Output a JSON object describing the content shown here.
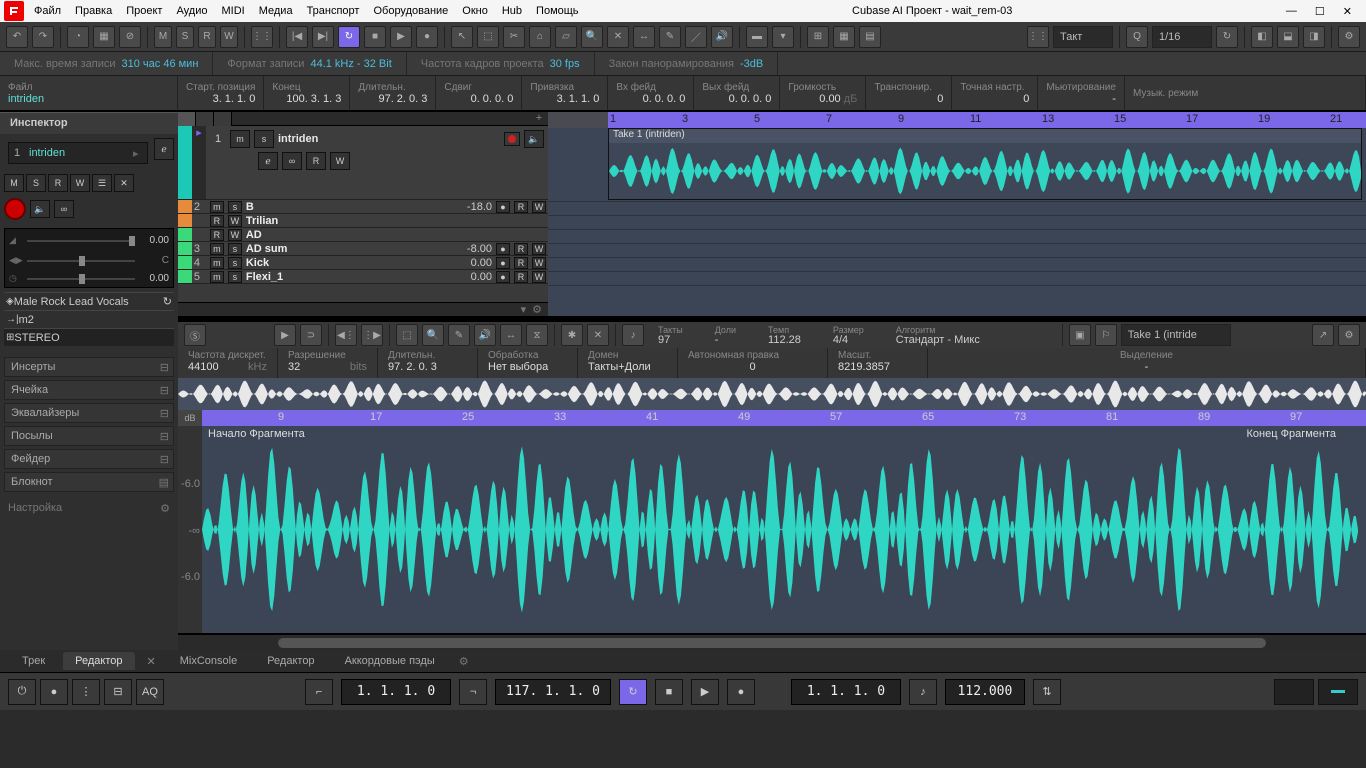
{
  "app_title": "Cubase AI Проект - wait_rem-03",
  "menu": [
    "Файл",
    "Правка",
    "Проект",
    "Аудио",
    "MIDI",
    "Медиа",
    "Транспорт",
    "Оборудование",
    "Окно",
    "Hub",
    "Помощь"
  ],
  "status": {
    "rec_time_lbl": "Макс. время записи",
    "rec_time": "310 час 46 мин",
    "fmt_lbl": "Формат записи",
    "fmt": "44.1 kHz - 32 Bit",
    "fps_lbl": "Частота кадров проекта",
    "fps": "30 fps",
    "pan_lbl": "Закон панорамирования",
    "pan": "-3dB"
  },
  "info_row": [
    {
      "lbl": "Файл",
      "val": "intriden",
      "left": true
    },
    {
      "lbl": "Старт. позиция",
      "val": "3. 1. 1.  0"
    },
    {
      "lbl": "Конец",
      "val": "100. 3. 1.  3"
    },
    {
      "lbl": "Длительн.",
      "val": "97. 2. 0.  3"
    },
    {
      "lbl": "Сдвиг",
      "val": "0. 0. 0.  0"
    },
    {
      "lbl": "Привязка",
      "val": "3. 1. 1.  0"
    },
    {
      "lbl": "Вх фейд",
      "val": "0. 0. 0.  0"
    },
    {
      "lbl": "Вых фейд",
      "val": "0. 0. 0.  0"
    },
    {
      "lbl": "Громкость",
      "val": "0.00",
      "unit": "дБ"
    },
    {
      "lbl": "Транспонир.",
      "val": "0"
    },
    {
      "lbl": "Точная настр.",
      "val": "0"
    },
    {
      "lbl": "Мьютирование",
      "val": "-"
    },
    {
      "lbl": "Музык. режим",
      "val": ""
    }
  ],
  "inspector": {
    "title": "Инспектор",
    "track_num": "1",
    "track_name": "intriden",
    "btns": [
      "M",
      "S",
      "R",
      "W",
      "☰",
      "✕"
    ],
    "vol": "0.00",
    "pan": "0.00",
    "preset": "Male Rock Lead Vocals",
    "routing": "m2",
    "cfg": "STEREO",
    "sections": [
      "Инсерты",
      "Ячейка",
      "Эквалайзеры",
      "Посылы",
      "Фейдер",
      "Блокнот"
    ],
    "settings": "Настройка"
  },
  "tracks": [
    {
      "num": "1",
      "name": "intriden",
      "color": "t",
      "big": true
    },
    {
      "num": "2",
      "name": "B",
      "gain": "-18.0",
      "color": "o"
    },
    {
      "num": " ",
      "name": "Trilian",
      "gain": "",
      "color": "o"
    },
    {
      "num": " ",
      "name": "AD",
      "gain": "",
      "color": "g"
    },
    {
      "num": "3",
      "name": "AD sum",
      "gain": "-8.00",
      "color": "g"
    },
    {
      "num": "4",
      "name": "Kick",
      "gain": "0.00",
      "color": "g"
    },
    {
      "num": "5",
      "name": "Flexi_1",
      "gain": "0.00",
      "color": "g"
    }
  ],
  "ruler_top": [
    "1",
    "3",
    "5",
    "7",
    "9",
    "11",
    "13",
    "15",
    "17",
    "19",
    "21"
  ],
  "clip_name": "Take 1 (intriden)",
  "editor": {
    "bars_lbl": "Такты",
    "bars": "97",
    "beats_lbl": "Доли",
    "beats": "-",
    "tempo_lbl": "Темп",
    "tempo": "112.28",
    "sig_lbl": "Размер",
    "sig": "4/4",
    "algo_lbl": "Алгоритм",
    "algo": "Стандарт - Микс",
    "take": "Take 1 (intride",
    "info": [
      {
        "lbl": "Частота дискрет.",
        "val": "44100",
        "unit": "kHz"
      },
      {
        "lbl": "Разрешение",
        "val": "32",
        "unit": "bits"
      },
      {
        "lbl": "Длительн.",
        "val": "97. 2. 0.  3"
      },
      {
        "lbl": "Обработка",
        "val": "Нет выбора"
      },
      {
        "lbl": "Домен",
        "val": "Такты+Доли"
      },
      {
        "lbl": "Автономная правка",
        "val": "0"
      },
      {
        "lbl": "Масшт.",
        "val": "8219.3857"
      },
      {
        "lbl": "Выделение",
        "val": "-"
      }
    ],
    "ruler": [
      "9",
      "17",
      "25",
      "33",
      "41",
      "49",
      "57",
      "65",
      "73",
      "81",
      "89",
      "97"
    ],
    "db_lbl": "dB",
    "scale": [
      "-∞",
      "-6.0",
      "-∞",
      "-6.0"
    ],
    "frag_start": "Начало Фрагмента",
    "frag_end": "Конец Фрагмента"
  },
  "toolbar_top": {
    "grid_lbl": "Такт",
    "quant": "1/16"
  },
  "bottom_tabs": [
    "Трек",
    "Редактор",
    "MixConsole",
    "Редактор",
    "Аккордовые пэды"
  ],
  "transport": {
    "pos_l": "1. 1. 1.  0",
    "pos_r": "117. 1. 1.  0",
    "loc": "1. 1. 1.  0",
    "tempo": "112.000"
  }
}
